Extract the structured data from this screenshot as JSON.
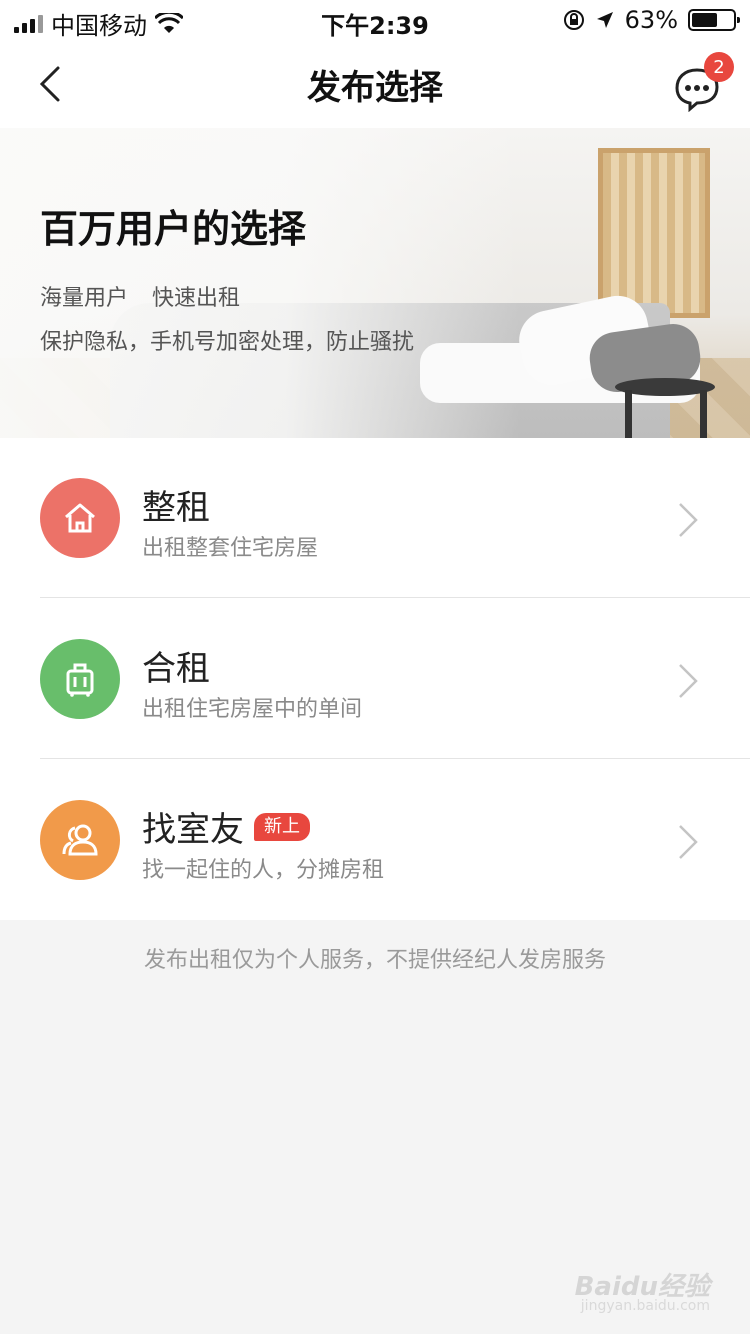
{
  "status_bar": {
    "carrier": "中国移动",
    "time": "下午2:39",
    "battery": "63%",
    "battery_level": 0.63
  },
  "nav": {
    "title": "发布选择",
    "message_badge": "2",
    "back_icon": "chevron-left-icon",
    "message_icon": "chat-bubble-icon"
  },
  "hero": {
    "title": "百万用户的选择",
    "feature_1": "海量用户",
    "feature_2": "快速出租",
    "privacy": "保护隐私，手机号加密处理，防止骚扰"
  },
  "options": [
    {
      "label": "整租",
      "sub": "出租整套住宅房屋",
      "icon": "house-icon",
      "color": "#ec7268"
    },
    {
      "label": "合租",
      "sub": "出租住宅房屋中的单间",
      "icon": "luggage-icon",
      "color": "#68be6b"
    },
    {
      "label": "找室友",
      "sub": "找一起住的人，分摊房租",
      "icon": "users-icon",
      "color": "#f19a4a",
      "tag": "新上"
    }
  ],
  "footer": {
    "note": "发布出租仅为个人服务，不提供经纪人发房服务"
  },
  "watermark": {
    "text": "Baidu经验",
    "url": "jingyan.baidu.com"
  }
}
